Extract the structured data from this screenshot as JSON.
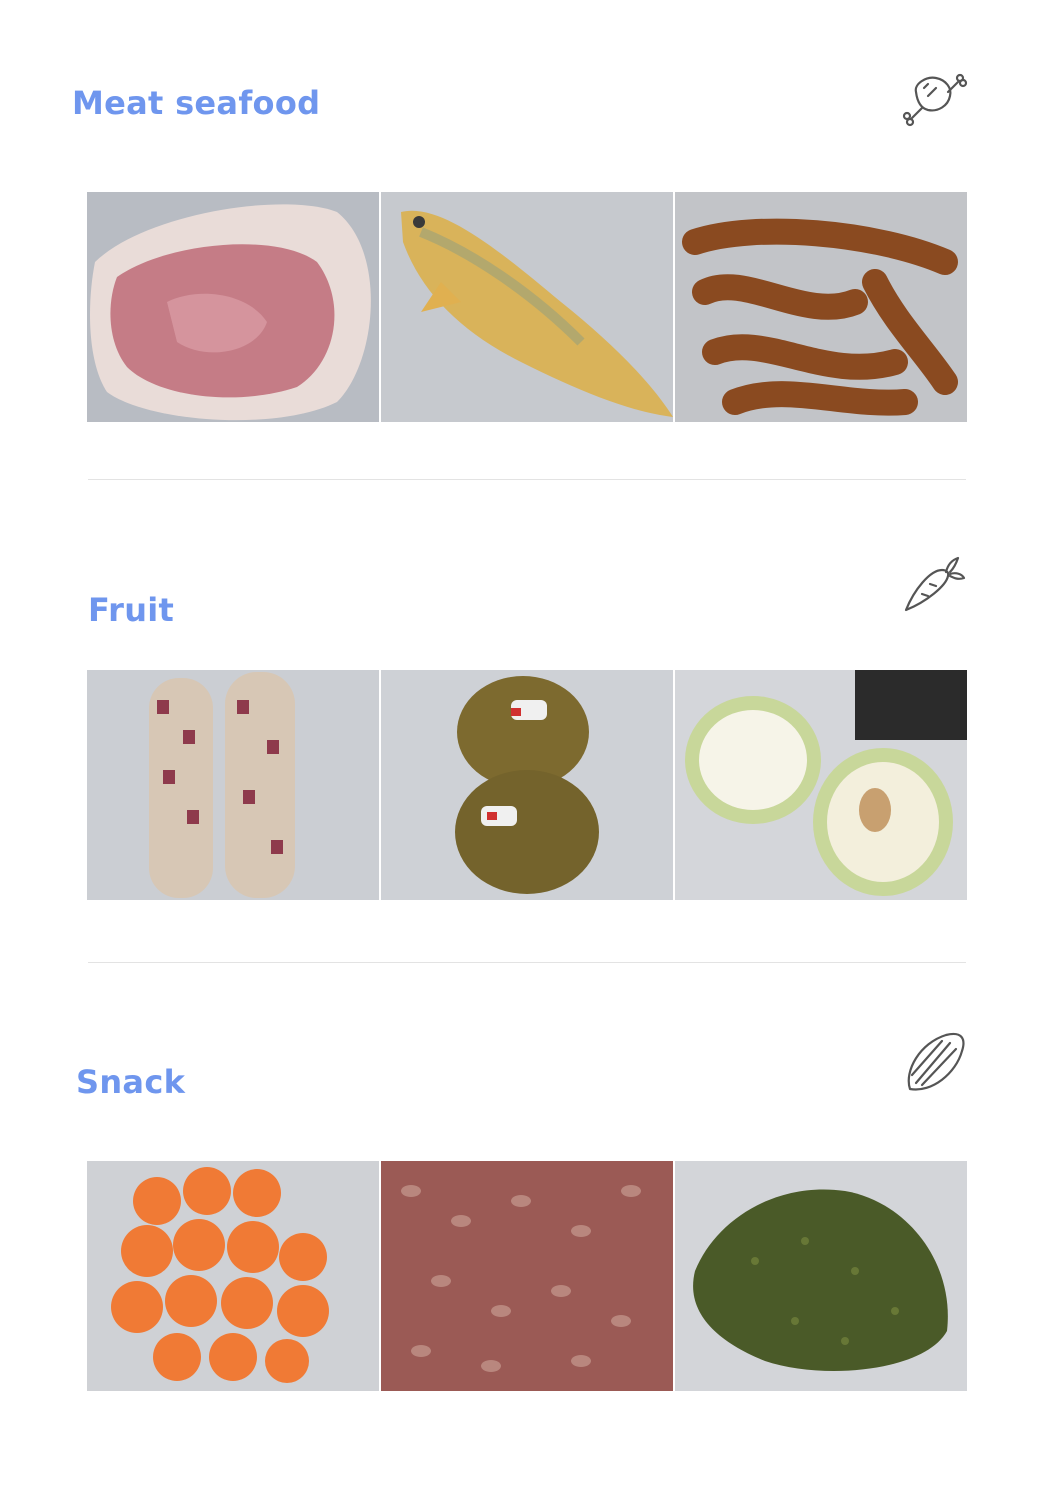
{
  "sections": [
    {
      "title": "Meat seafood",
      "icon": "meat-icon",
      "photos": [
        {
          "subject": "pork-chop",
          "color": "#c57c86"
        },
        {
          "subject": "yellow-croaker-fish",
          "color": "#d9b35a"
        },
        {
          "subject": "sausages",
          "color": "#8a4a20"
        }
      ]
    },
    {
      "title": "Fruit",
      "icon": "carrot-icon",
      "photos": [
        {
          "subject": "corn",
          "color": "#8e3a4c"
        },
        {
          "subject": "kiwi",
          "color": "#7d6a2f"
        },
        {
          "subject": "pear-halves",
          "color": "#d6e59c"
        }
      ]
    },
    {
      "title": "Snack",
      "icon": "seed-icon",
      "photos": [
        {
          "subject": "candied-kumquats",
          "color": "#f07a35"
        },
        {
          "subject": "red-beans",
          "color": "#9b5a55"
        },
        {
          "subject": "mung-beans",
          "color": "#4a5a28"
        }
      ]
    }
  ],
  "colors": {
    "title": "#6f96ee",
    "divider": "#e3e3e3",
    "icon": "#555555"
  }
}
